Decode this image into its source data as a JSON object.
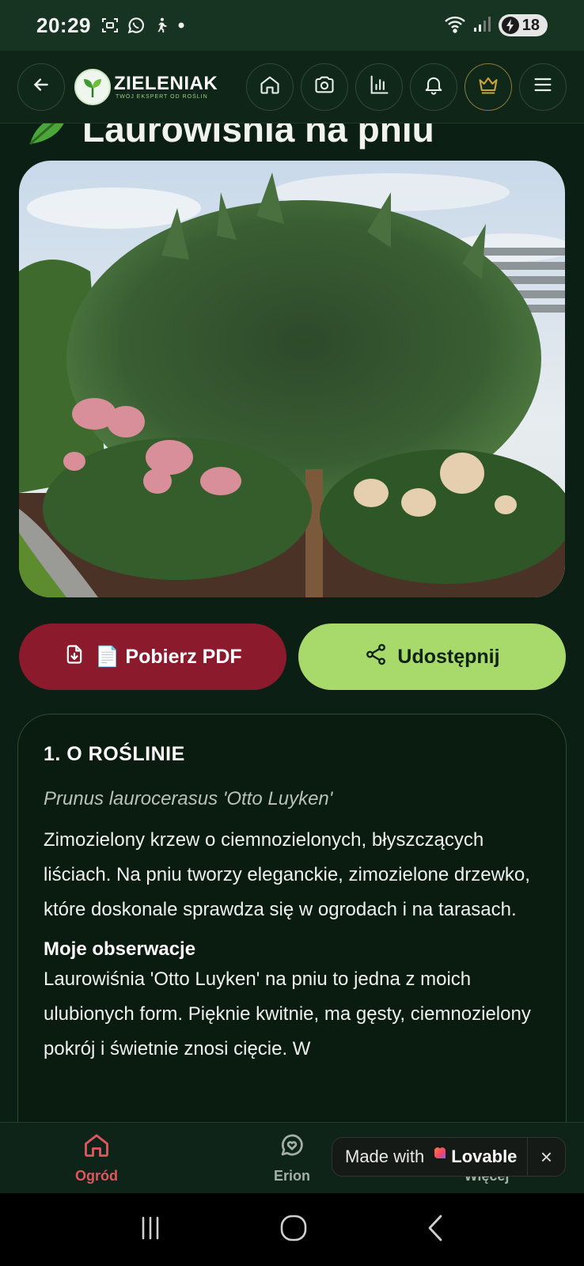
{
  "status_bar": {
    "time": "20:29",
    "battery": "18",
    "icons": [
      "screenshot-icon",
      "whatsapp-icon",
      "walking-icon",
      "dot-icon",
      "wifi-icon",
      "signal-icon",
      "battery-icon"
    ]
  },
  "header": {
    "logo_name": "ZIELENIAK",
    "logo_tagline": "TWÓJ EKSPERT OD ROŚLIN",
    "icons": [
      "back-icon",
      "home-icon",
      "camera-icon",
      "stats-icon",
      "bell-icon",
      "crown-icon",
      "menu-icon"
    ],
    "accent_color": "#c8a43a"
  },
  "page": {
    "title": "Laurowiśnia na pniu"
  },
  "actions": {
    "pdf_label": "📄 Pobierz PDF",
    "share_label": "Udostępnij",
    "pdf_color": "#8b1a2c",
    "share_color": "#a7da6a"
  },
  "section": {
    "heading": "1. O ROŚLINIE",
    "latin_name": "Prunus laurocerasus 'Otto Luyken'",
    "description": "Zimozielony krzew o ciemnozielonych, błyszczących liściach. Na pniu tworzy eleganckie, zimozielone drzewko, które doskonale sprawdza się w ogrodach i na tarasach.",
    "observations_title": "Moje obserwacje",
    "observations_text": "Laurowiśnia 'Otto Luyken' na pniu to jedna z moich ulubionych form. Pięknie kwitnie, ma gęsty, ciemnozielony pokrój i świetnie znosi cięcie. W"
  },
  "bottom_nav": {
    "items": [
      {
        "label": "Ogród",
        "icon": "home-icon",
        "active": true
      },
      {
        "label": "Erion",
        "icon": "chat-heart-icon",
        "active": false
      },
      {
        "label": "Więcej",
        "icon": "more-icon",
        "active": false
      }
    ],
    "active_color": "#e0565f"
  },
  "badge": {
    "made_with": "Made with",
    "brand": "Lovable",
    "close": "×"
  }
}
